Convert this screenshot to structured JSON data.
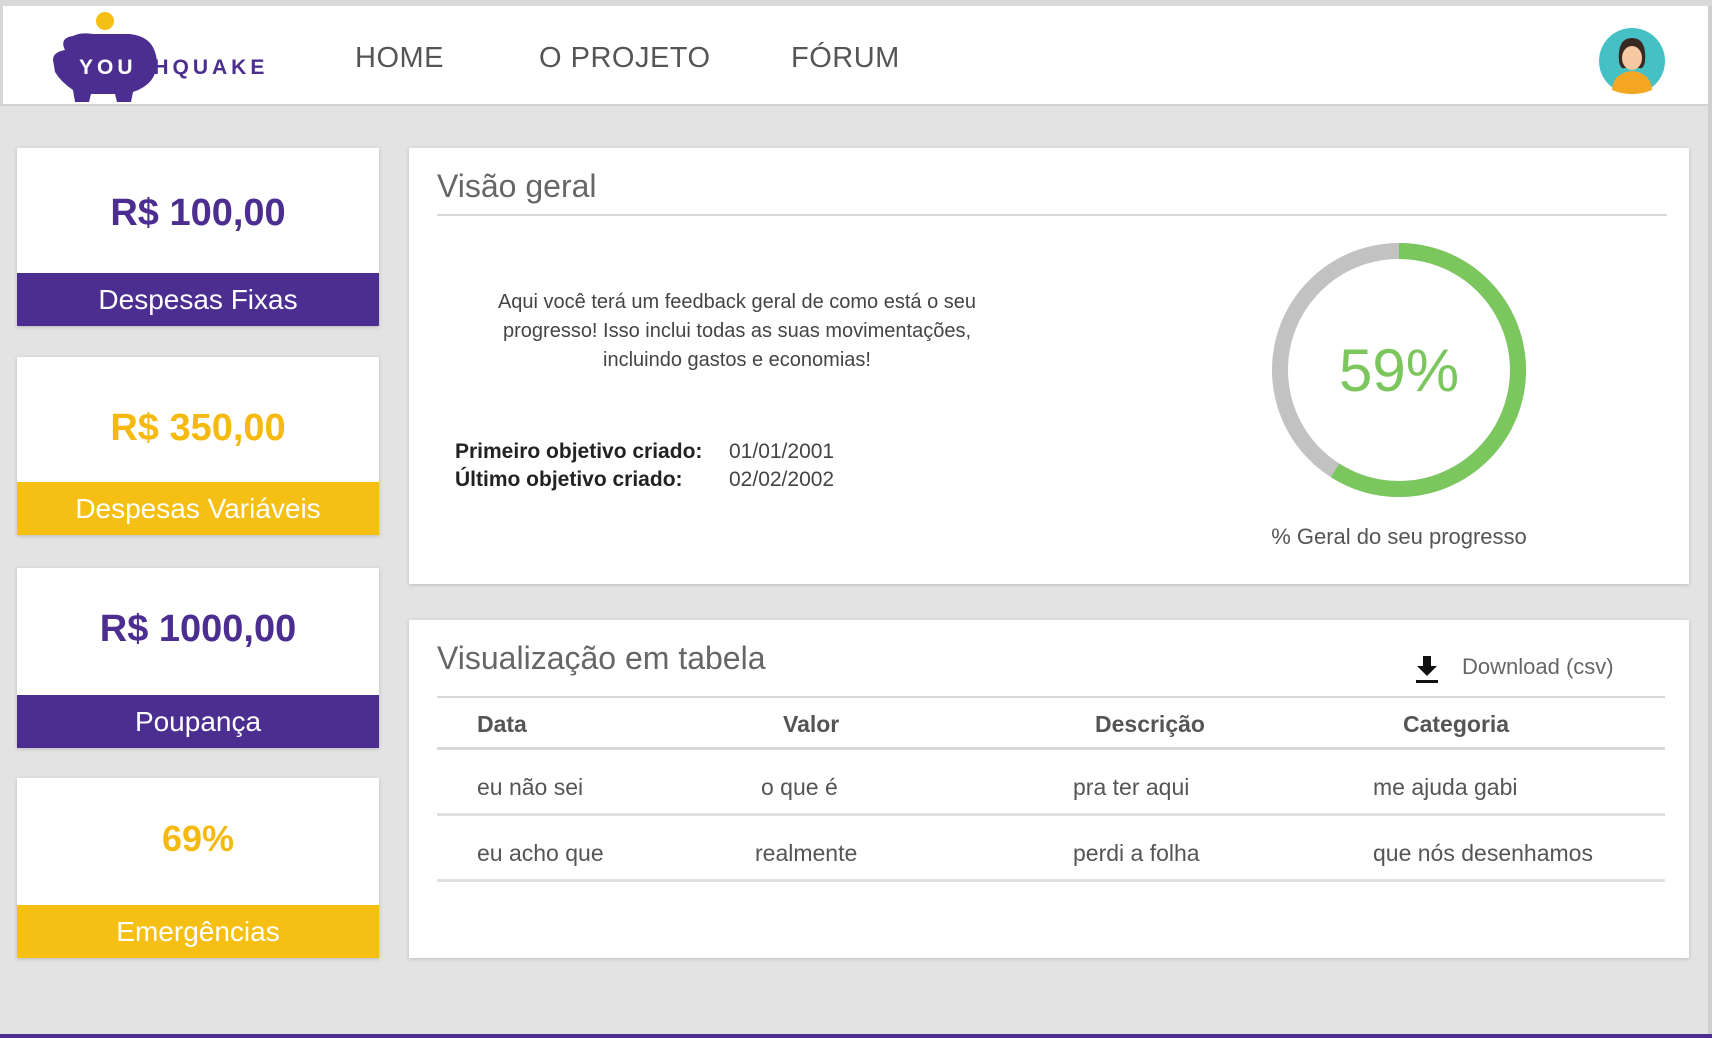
{
  "brand": {
    "name_part_white": "YOU",
    "name_part_purple": "THQUAKE",
    "colors": {
      "purple": "#4b2e8f",
      "yellow": "#f5bf14",
      "green": "#7cc65e",
      "gray": "#c2c2c2"
    }
  },
  "nav": {
    "items": [
      {
        "label": "HOME"
      },
      {
        "label": "O PROJETO"
      },
      {
        "label": "FÓRUM"
      }
    ],
    "avatar_icon": "user-avatar-icon"
  },
  "stats": [
    {
      "value": "R$ 100,00",
      "label": "Despesas Fixas",
      "color": "purple"
    },
    {
      "value": "R$ 350,00",
      "label": "Despesas Variáveis",
      "color": "yellow"
    },
    {
      "value": "R$ 1000,00",
      "label": "Poupança",
      "color": "purple"
    },
    {
      "value": "69%",
      "label": "Emergências",
      "color": "yellow"
    }
  ],
  "overview": {
    "title": "Visão geral",
    "description": "Aqui você terá um feedback geral de como está o seu progresso! Isso inclui todas as suas movimentações, incluindo gastos e economias!",
    "first_goal_label": "Primeiro objetivo criado:",
    "first_goal_value": "01/01/2001",
    "last_goal_label": "Último objetivo criado:",
    "last_goal_value": "02/02/2002",
    "progress_text": "59%",
    "progress_value": 0.59,
    "progress_caption": "% Geral do seu progresso"
  },
  "table": {
    "title": "Visualização em tabela",
    "download_label": "Download (csv)",
    "download_icon": "download-icon",
    "columns": [
      "Data",
      "Valor",
      "Descrição",
      "Categoria"
    ],
    "rows": [
      [
        "eu não sei",
        "o que é",
        "pra ter aqui",
        "me ajuda gabi"
      ],
      [
        "eu acho que",
        "realmente",
        "perdi a folha",
        "que nós desenhamos"
      ]
    ]
  }
}
